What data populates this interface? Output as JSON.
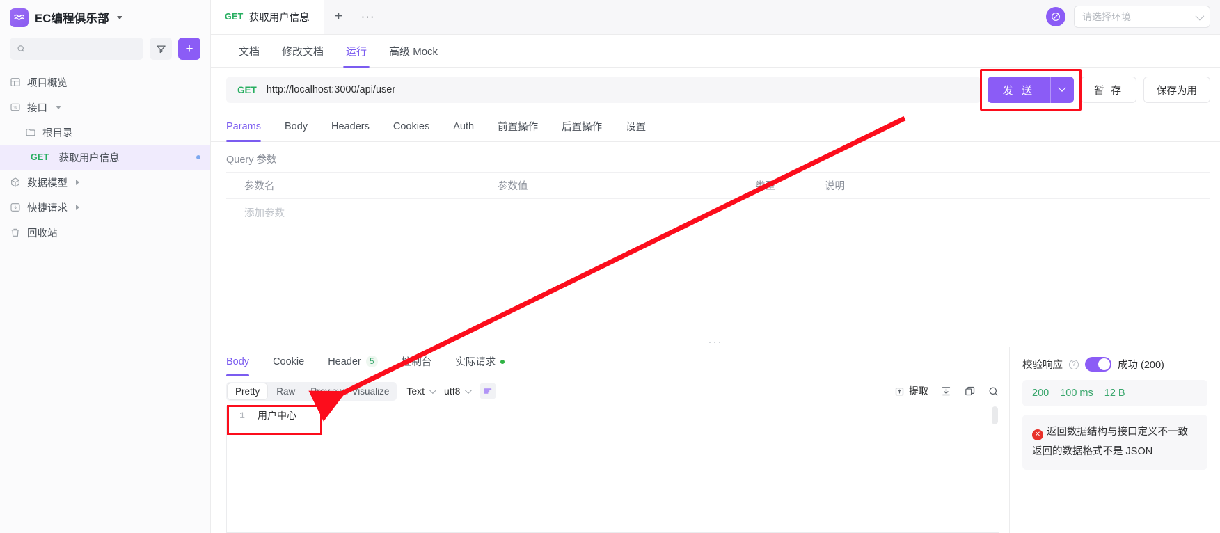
{
  "sidebar": {
    "brand": {
      "name": "EC编程俱乐部",
      "logo_icon": "wave-logo-icon"
    },
    "search": {
      "placeholder": "",
      "value": "",
      "icon": "search-icon"
    },
    "filter_icon": "filter-icon",
    "add_label": "+",
    "items": [
      {
        "label": "项目概览",
        "icon": "layout-icon"
      },
      {
        "label": "接口",
        "icon": "api-icon"
      },
      {
        "label": "根目录",
        "icon": "folder-icon"
      },
      {
        "label": "获取用户信息",
        "method": "GET"
      },
      {
        "label": "数据模型",
        "icon": "cube-icon"
      },
      {
        "label": "快捷请求",
        "icon": "bolt-icon"
      },
      {
        "label": "回收站",
        "icon": "trash-icon"
      }
    ]
  },
  "topbar": {
    "tab": {
      "method": "GET",
      "title": "获取用户信息"
    },
    "new_tab_label": "+",
    "more_label": "···",
    "env": {
      "placeholder": "请选择环境",
      "globe_icon": "globe-icon"
    }
  },
  "subtabs": [
    {
      "label": "文档",
      "active": false
    },
    {
      "label": "修改文档",
      "active": false
    },
    {
      "label": "运行",
      "active": true
    },
    {
      "label": "高级 Mock",
      "active": false
    }
  ],
  "request": {
    "method": "GET",
    "url": "http://localhost:3000/api/user",
    "send_label": "发 送",
    "save_draft_label": "暂 存",
    "save_as_label": "保存为用",
    "tabs": [
      {
        "label": "Params",
        "active": true
      },
      {
        "label": "Body",
        "active": false
      },
      {
        "label": "Headers",
        "active": false
      },
      {
        "label": "Cookies",
        "active": false
      },
      {
        "label": "Auth",
        "active": false
      },
      {
        "label": "前置操作",
        "active": false
      },
      {
        "label": "后置操作",
        "active": false
      },
      {
        "label": "设置",
        "active": false
      }
    ],
    "query_section_label": "Query 参数",
    "table": {
      "headers": [
        "参数名",
        "参数值",
        "类型",
        "说明"
      ],
      "placeholder_row": "添加参数"
    }
  },
  "response": {
    "tabs": [
      {
        "label": "Body",
        "active": true
      },
      {
        "label": "Cookie",
        "active": false
      },
      {
        "label": "Header",
        "active": false,
        "count": "5"
      },
      {
        "label": "控制台",
        "active": false
      },
      {
        "label": "实际请求",
        "active": false,
        "dot": true
      }
    ],
    "formatter": {
      "segments": [
        {
          "label": "Pretty",
          "active": true
        },
        {
          "label": "Raw",
          "active": false
        },
        {
          "label": "Preview / Visualize",
          "active": false
        }
      ],
      "type_select": "Text",
      "encoding_select": "utf8",
      "wrap_icon": "wrap-lines-icon",
      "extract_label": "提取",
      "extract_icon": "extract-icon",
      "download_icon": "download-icon",
      "copy_icon": "copy-icon",
      "search_icon": "search-icon"
    },
    "body": {
      "line_number": "1",
      "content": "用户中心"
    },
    "status_panel": {
      "verify_label": "校验响应",
      "verify_help_icon": "question-icon",
      "verify_enabled": true,
      "verify_result": "成功 (200)",
      "stats": [
        "200",
        "100 ms",
        "12 B"
      ],
      "warnings": [
        "返回数据结构与接口定义不一致",
        "返回的数据格式不是 JSON"
      ],
      "warning_icon": "error-circle-icon"
    }
  },
  "annotations": {
    "highlight_color": "#fc0d1c",
    "arrow_from": "send-button",
    "arrow_to": "response-body"
  },
  "colors": {
    "accent": "#8b5cf6",
    "method_get": "#27ae60",
    "success": "#3aa76d",
    "error": "#e8312a"
  }
}
